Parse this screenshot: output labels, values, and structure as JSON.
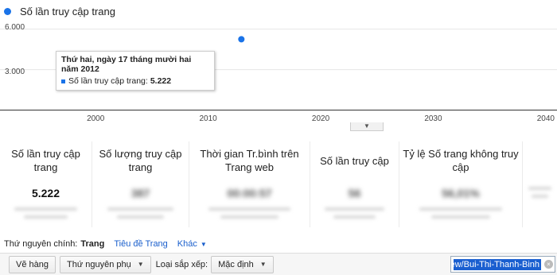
{
  "colors": {
    "series": "#1a73e8",
    "link": "#1a5fcc",
    "filter_highlight": "#1a5fd0"
  },
  "chart_data": {
    "type": "scatter",
    "series": [
      {
        "name": "Số lần truy cập trang",
        "points": [
          {
            "x": 2012.95,
            "y": 5222
          }
        ]
      }
    ],
    "xlim": [
      1991.5,
      2041
    ],
    "ylim": [
      0,
      6600
    ],
    "xticks": [
      "2000",
      "2010",
      "2020",
      "2030",
      "2040"
    ],
    "yticks": [
      "6.000",
      "3.000"
    ],
    "xtick_values": [
      2000,
      2010,
      2020,
      2030,
      2040
    ],
    "ytick_values": [
      6000,
      3000
    ],
    "grid": true,
    "legend": "top-left"
  },
  "tooltip": {
    "title": "Thứ hai, ngày 17 tháng mười hai năm 2012",
    "series_label": "Số lần truy cập trang:",
    "value": "5.222"
  },
  "collapse_icon": "▼",
  "metrics": [
    {
      "label": "Số lần truy cập trang",
      "value": "5.222",
      "blurred": false
    },
    {
      "label": "Số lượng truy cập trang",
      "value": "387",
      "blurred": true
    },
    {
      "label": "Thời gian Tr.bình trên Trang web",
      "value": "00:00:57",
      "blurred": true
    },
    {
      "label": "Số lần truy cập",
      "value": "56",
      "blurred": true
    },
    {
      "label": "Tỷ lệ Số trang không truy cập",
      "value": "56,01%",
      "blurred": true
    },
    {
      "label": "",
      "value": "",
      "blurred": true
    }
  ],
  "dimensions": {
    "label": "Thứ nguyên chính:",
    "active": "Trang",
    "link": "Tiêu đề Trang",
    "more": "Khác"
  },
  "toolbar": {
    "rows_button": "Vẽ hàng",
    "secondary_dimension": "Thứ nguyên phụ",
    "sort_label": "Loại sắp xếp:",
    "sort_value": "Mặc định",
    "filter_value": "ew/Bui-Thi-Thanh-Binh",
    "clear_icon": "×"
  }
}
